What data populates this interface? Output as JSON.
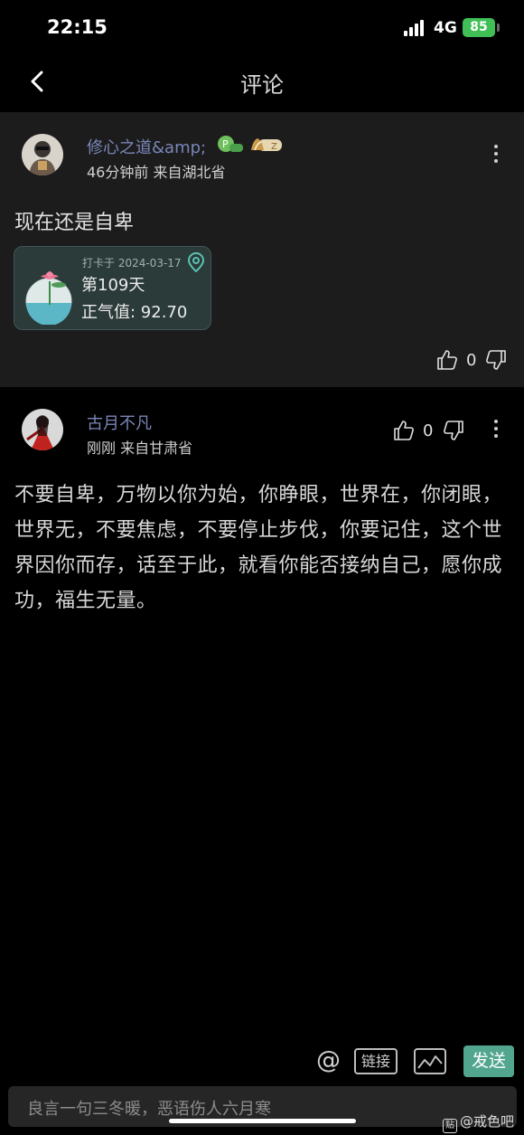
{
  "status_bar": {
    "time": "22:15",
    "network": "4G",
    "battery": "85"
  },
  "nav": {
    "title": "评论"
  },
  "main_post": {
    "username": "修心之道&amp;",
    "badge_level": "Z",
    "meta": "46分钟前  来自湖北省",
    "text": "现在还是自卑",
    "checkin": {
      "date": "打卡于 2024-03-17",
      "days": "第109天",
      "score": "正气值:  92.70"
    },
    "likes": "0"
  },
  "reply": {
    "username": "古月不凡",
    "meta": "刚刚  来自甘肃省",
    "likes": "0",
    "text": "不要自卑，万物以你为始，你睁眼，世界在，你闭眼，世界无，不要焦虑，不要停止步伐，你要记住，这个世界因你而存，话至于此，就看你能否接纳自己，愿你成功，福生无量。"
  },
  "toolbar": {
    "at": "@",
    "link_label": "链接",
    "send_label": "发送"
  },
  "input": {
    "placeholder": "良言一句三冬暖，恶语伤人六月寒"
  },
  "watermark": {
    "logo": "贴",
    "text": "@戒色吧"
  },
  "colors": {
    "accent": "#53a68e",
    "username": "#7a86b8",
    "battery": "#3fbf55"
  }
}
